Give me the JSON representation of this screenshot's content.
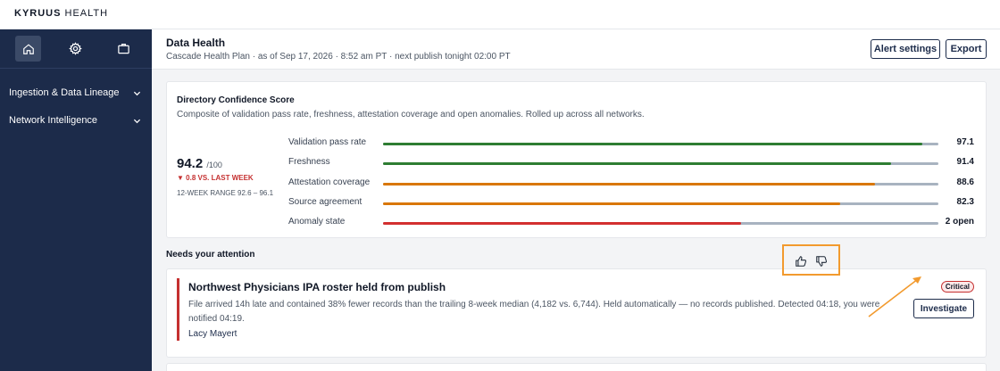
{
  "brand": {
    "bold": "KYRUUS",
    "rest": " HEALTH"
  },
  "sidebar": {
    "icons": [
      "home-icon",
      "gear-icon",
      "briefcase-icon"
    ],
    "items": [
      {
        "label": "Ingestion & Data Lineage"
      },
      {
        "label": "Network Intelligence"
      }
    ]
  },
  "header": {
    "title": "Data Health",
    "subtitle": "Cascade Health Plan · as of Sep 17, 2026 · 8:52 am PT · next publish tonight 02:00 PT",
    "alert_settings_label": "Alert settings",
    "export_label": "Export"
  },
  "confidence": {
    "title": "Directory Confidence Score",
    "description": "Composite of validation pass rate, freshness, attestation coverage and open anomalies. Rolled up across all networks.",
    "score": "94.2",
    "score_of": "/100",
    "delta": "▼ 0.8 VS. LAST WEEK",
    "range": "12-WEEK RANGE 92.6 – 96.1",
    "metrics": [
      {
        "label": "Validation pass rate",
        "value": "97.1",
        "fraction": 0.971,
        "color": "#2e7d32"
      },
      {
        "label": "Freshness",
        "value": "91.4",
        "fraction": 0.914,
        "color": "#2e7d32"
      },
      {
        "label": "Attestation coverage",
        "value": "88.6",
        "fraction": 0.886,
        "color": "#d97706"
      },
      {
        "label": "Source agreement",
        "value": "82.3",
        "fraction": 0.823,
        "color": "#d97706"
      },
      {
        "label": "Anomaly state",
        "value": "2 open",
        "fraction": 0.645,
        "color": "#d32f2f"
      }
    ]
  },
  "attention": {
    "title": "Needs your attention",
    "alert": {
      "title": "Northwest Physicians IPA roster held from publish",
      "description": "File arrived 14h late and contained 38% fewer records than the trailing 8-week median (4,182 vs. 6,744). Held automatically — no records published. Detected 04:18, you were notified 04:19.",
      "owner": "Lacy Mayert",
      "badge": "Critical",
      "action_label": "Investigate"
    }
  },
  "colors": {
    "navy": "#1c2b4a",
    "highlight": "#f29a2e",
    "critical": "#c53030"
  }
}
